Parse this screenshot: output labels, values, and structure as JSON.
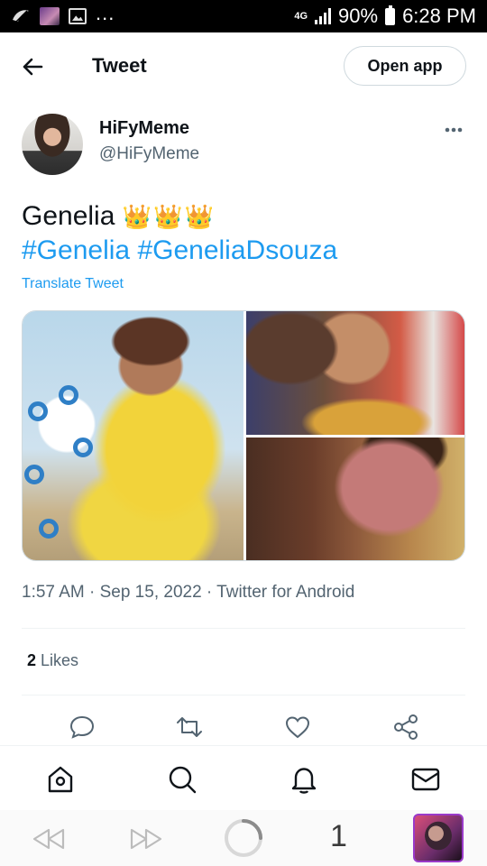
{
  "status_bar": {
    "network": "4G",
    "battery": "90%",
    "time": "6:28 PM",
    "overflow": "..."
  },
  "header": {
    "title": "Tweet",
    "open_app_label": "Open app"
  },
  "tweet": {
    "author_name": "HiFyMeme",
    "author_handle": "@HiFyMeme",
    "text": "Genelia",
    "crowns": "👑👑👑",
    "hashtags": [
      "#Genelia",
      "#GeneliaDsouza"
    ],
    "translate_label": "Translate Tweet",
    "timestamp": "1:57 AM · Sep 15, 2022 · Twitter for Android",
    "likes_count": "2",
    "likes_label": "Likes",
    "photo_count": 3
  },
  "actions": [
    "reply-icon",
    "retweet-icon",
    "like-icon",
    "share-icon"
  ],
  "bottom_nav": [
    "home-icon",
    "search-icon",
    "notifications-icon",
    "messages-icon"
  ],
  "browser_bar": {
    "tab_count": "1"
  },
  "colors": {
    "accent": "#1d9bf0",
    "text": "#0f1419",
    "secondary": "#536471",
    "tab_border": "#9a3ac9"
  }
}
